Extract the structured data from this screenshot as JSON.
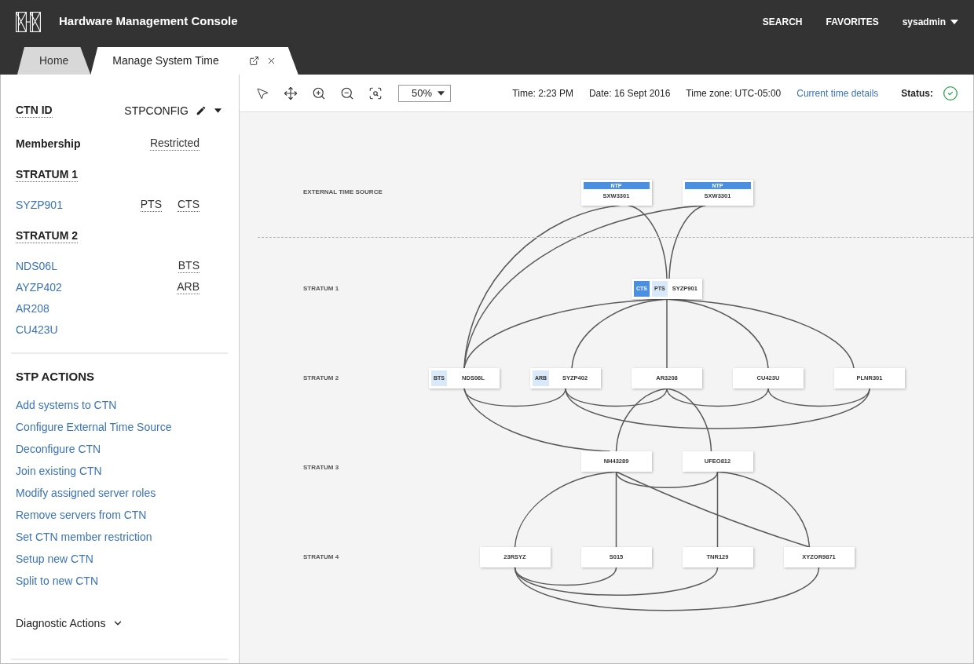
{
  "header": {
    "title": "Hardware Management Console",
    "links": [
      "SEARCH",
      "FAVORITES"
    ],
    "user": "sysadmin"
  },
  "tabs": [
    {
      "label": "Home",
      "selected": false,
      "closable": false
    },
    {
      "label": "Manage System Time",
      "selected": true,
      "closable": true
    }
  ],
  "sidebar": {
    "ctn": {
      "label": "CTN ID",
      "value": "STPCONFIG"
    },
    "membership": {
      "label": "Membership",
      "value": "Restricted"
    },
    "strata": [
      {
        "title": "STRATUM 1",
        "systems": [
          {
            "name": "SYZP901",
            "roles": [
              "PTS",
              "CTS"
            ]
          }
        ]
      },
      {
        "title": "STRATUM 2",
        "systems": [
          {
            "name": "NDS06L",
            "roles": [
              "BTS"
            ]
          },
          {
            "name": "AYZP402",
            "roles": [
              "ARB"
            ]
          },
          {
            "name": "AR208"
          },
          {
            "name": "CU423U"
          }
        ]
      }
    ],
    "actions_title": "STP ACTIONS",
    "actions": [
      "Add systems to CTN",
      "Configure External Time Source",
      "Deconfigure CTN",
      "Join existing CTN",
      "Modify assigned server roles",
      "Remove servers from CTN",
      "Set CTN member restriction",
      "Setup new CTN",
      "Split to new CTN"
    ],
    "diagnostic": {
      "label": "Diagnostic Actions",
      "expanded": false
    }
  },
  "toolbar": {
    "zoom": "50%",
    "time": "Time: 2:23 PM",
    "date": "Date: 16 Sept 2016",
    "timezone": "Time zone: UTC-05:00",
    "details_link": "Current time details",
    "status": {
      "label": "Status:",
      "ok": true
    }
  },
  "diagram": {
    "levels": [
      {
        "label": "EXTERNAL TIME SOURCE",
        "nodes": [
          {
            "name": "SXW3301",
            "header": "NTP"
          },
          {
            "name": "SXW3301",
            "header": "NTP"
          }
        ]
      },
      {
        "label": "STRATUM 1",
        "nodes": [
          {
            "name": "SYZP901",
            "badges": [
              {
                "label": "CTS",
                "active": true
              },
              {
                "label": "PTS",
                "active": false
              }
            ]
          }
        ]
      },
      {
        "label": "STRATUM 2",
        "nodes": [
          {
            "name": "NDS06L",
            "badges": [
              {
                "label": "BTS",
                "active": false
              }
            ]
          },
          {
            "name": "SYZP402",
            "badges": [
              {
                "label": "ARB",
                "active": false
              }
            ]
          },
          {
            "name": "AR3208"
          },
          {
            "name": "CU423U"
          },
          {
            "name": "PLNR301"
          }
        ]
      },
      {
        "label": "STRATUM 3",
        "nodes": [
          {
            "name": "NH43289"
          },
          {
            "name": "UFEO812"
          }
        ]
      },
      {
        "label": "STRATUM 4",
        "nodes": [
          {
            "name": "23RSYZ"
          },
          {
            "name": "S015"
          },
          {
            "name": "TNR129"
          },
          {
            "name": "XYZOR9871"
          }
        ]
      }
    ]
  }
}
